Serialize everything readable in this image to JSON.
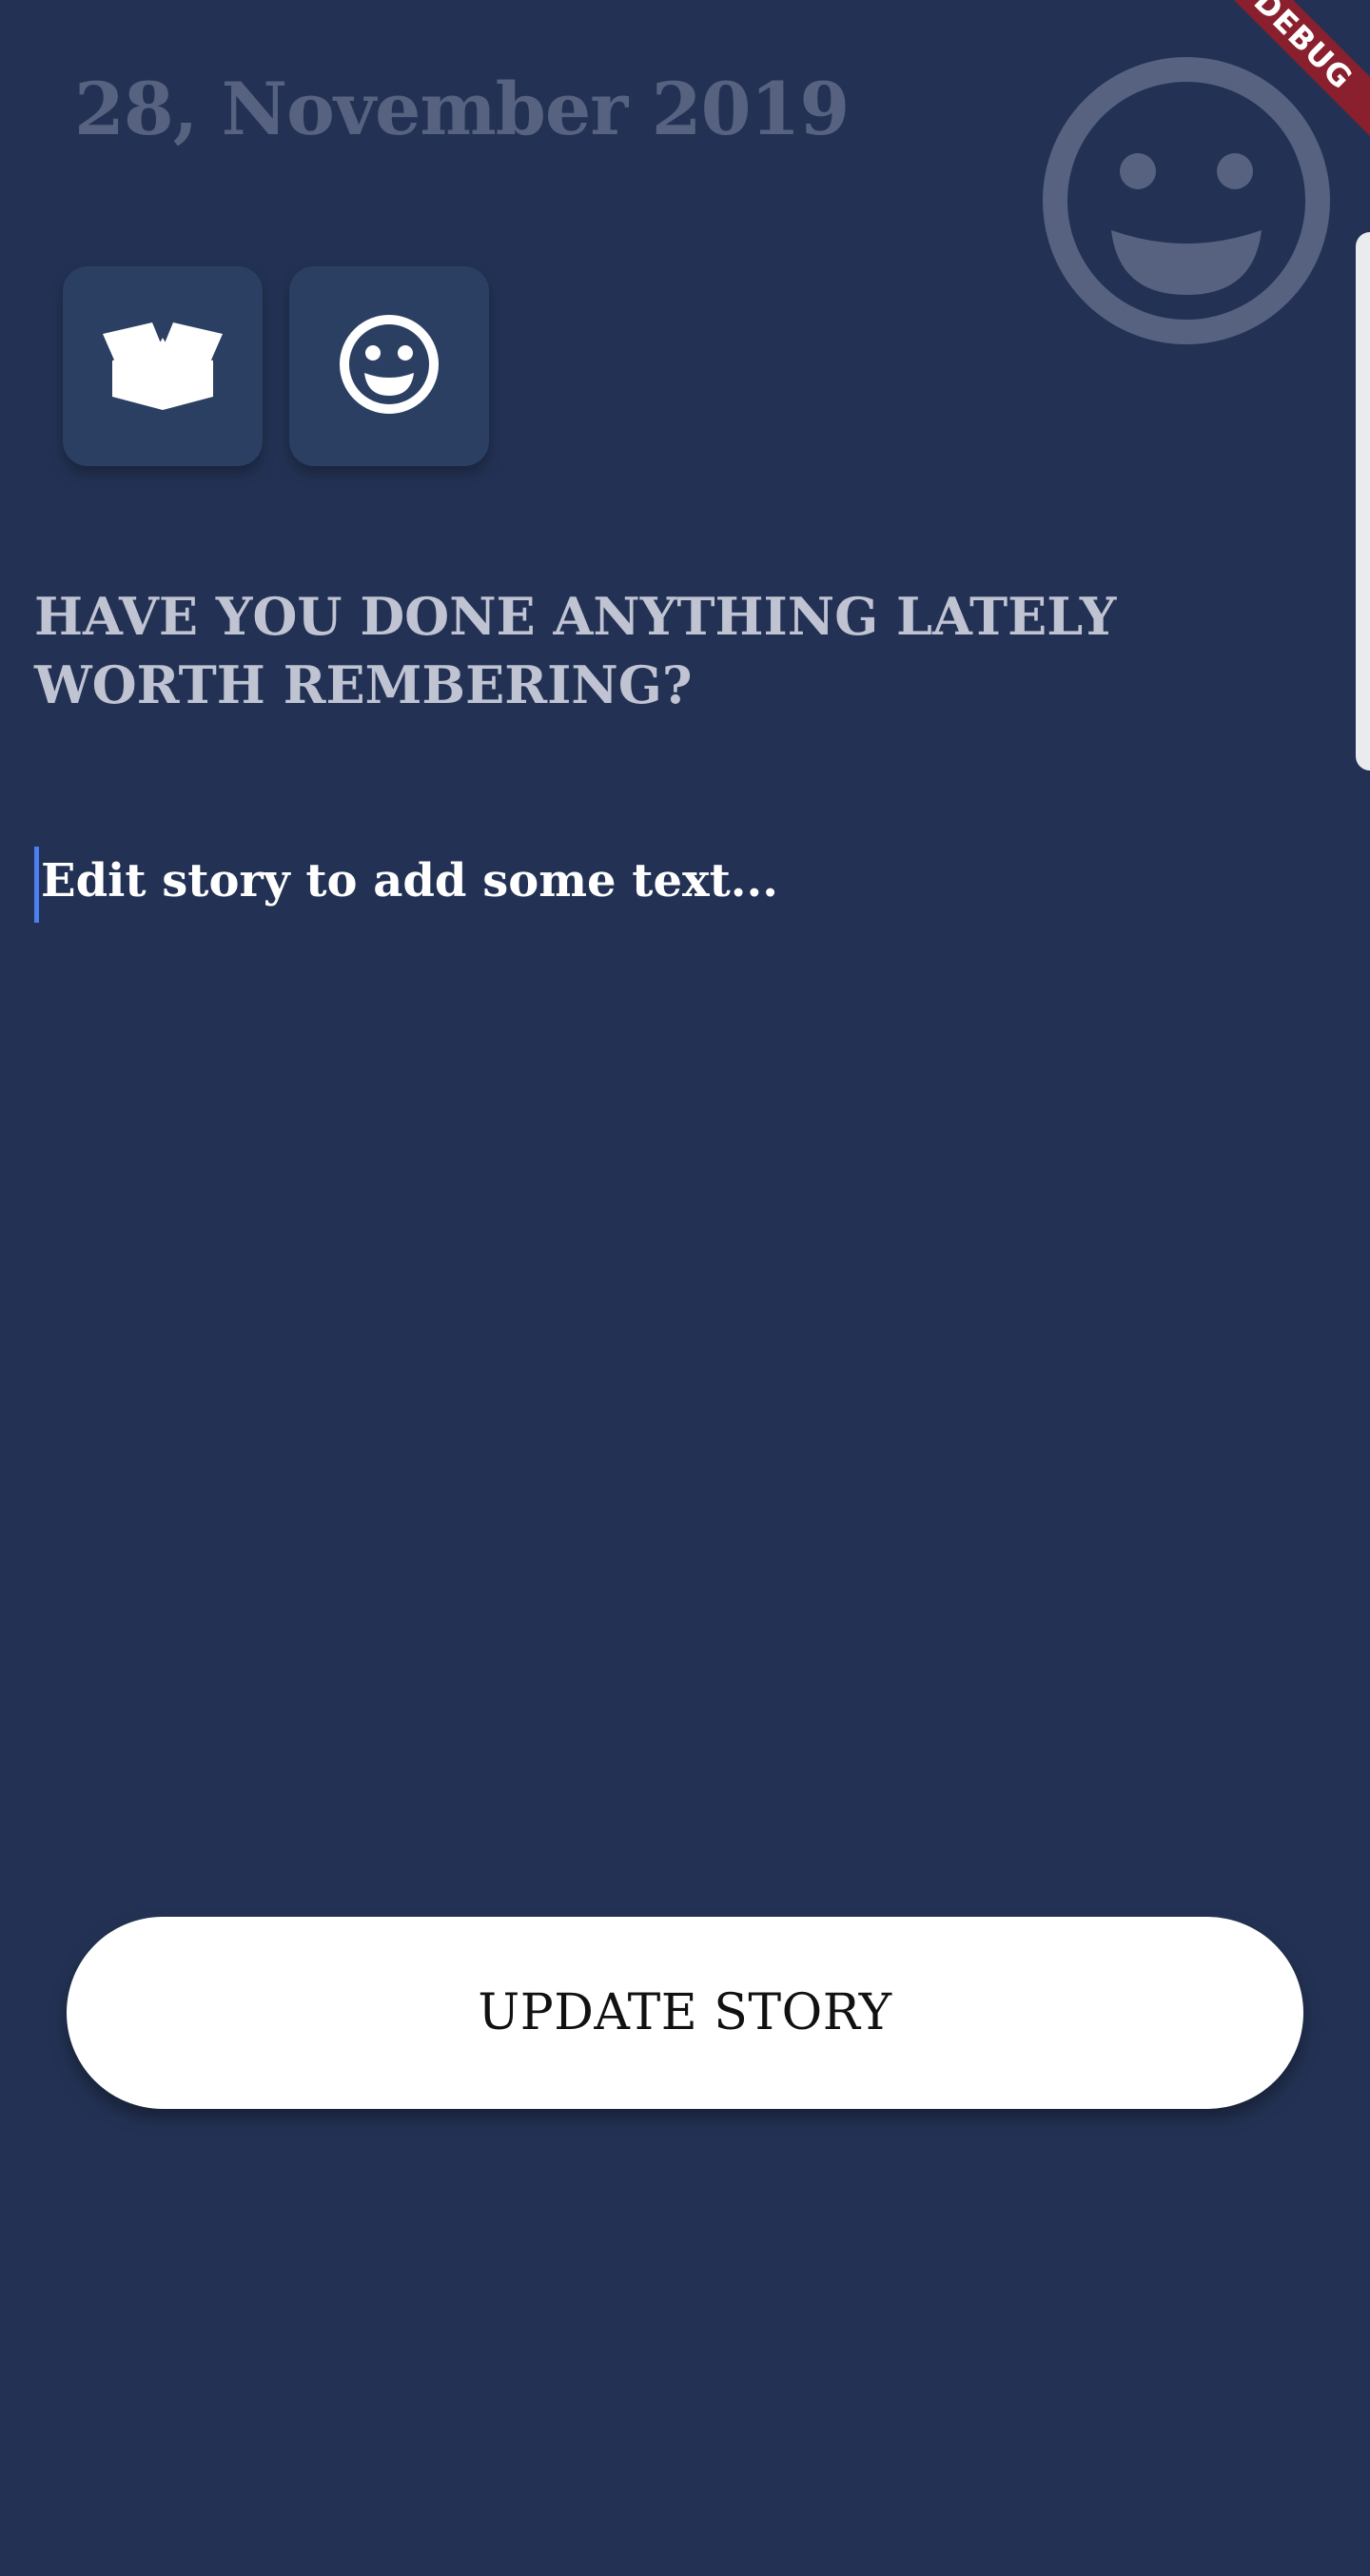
{
  "header": {
    "date": "28, November 2019",
    "mood_icon": "smiley-face-icon"
  },
  "debug_banner": {
    "label": "DEBUG"
  },
  "tiles": [
    {
      "icon": "open-box-icon"
    },
    {
      "icon": "smiley-face-icon"
    }
  ],
  "prompt": {
    "text": "HAVE YOU DONE ANYTHING LATELY WORTH REMBERING?"
  },
  "story": {
    "value": "Edit story to add some text..."
  },
  "button": {
    "label": "UPDATE STORY"
  },
  "colors": {
    "background": "#233254",
    "tile": "#2b3f63",
    "accent_cursor": "#4d7ef2",
    "debug": "#8a1f2d"
  }
}
